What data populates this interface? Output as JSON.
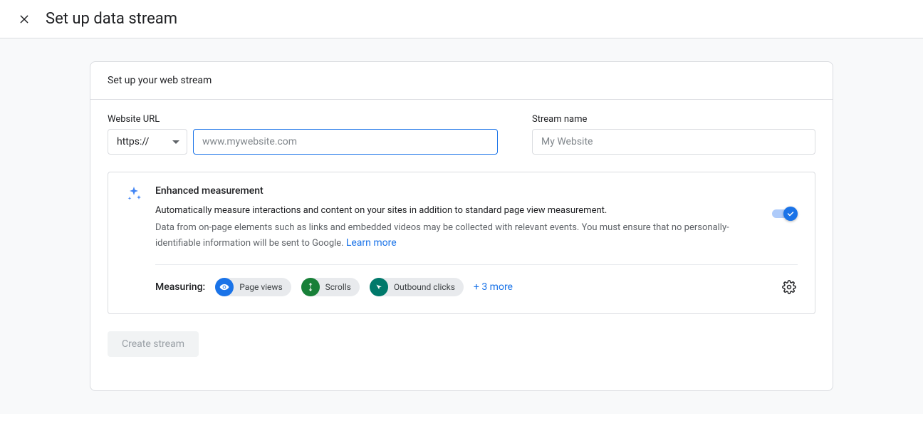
{
  "header": {
    "title": "Set up data stream"
  },
  "card": {
    "title": "Set up your web stream",
    "website_url_label": "Website URL",
    "protocol": "https://",
    "url_placeholder": "www.mywebsite.com",
    "stream_name_label": "Stream name",
    "stream_name_placeholder": "My Website"
  },
  "enhanced": {
    "title": "Enhanced measurement",
    "desc": "Automatically measure interactions and content on your sites in addition to standard page view measurement.",
    "note": "Data from on-page elements such as links and embedded videos may be collected with relevant events. You must ensure that no personally-identifiable information will be sent to Google.",
    "learn_more": "Learn more",
    "measuring_label": "Measuring:",
    "chips": {
      "page_views": "Page views",
      "scrolls": "Scrolls",
      "outbound": "Outbound clicks"
    },
    "more": "+ 3 more"
  },
  "actions": {
    "create": "Create stream"
  }
}
